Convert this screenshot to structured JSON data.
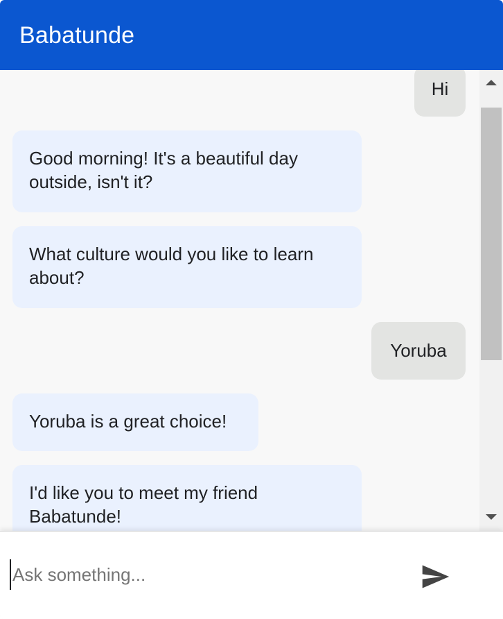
{
  "header": {
    "title": "Babatunde"
  },
  "messages": [
    {
      "sender": "user",
      "text": "Hi"
    },
    {
      "sender": "bot",
      "text": "Good morning! It's a beautiful day outside, isn't it?"
    },
    {
      "sender": "bot",
      "text": "What culture would you like to learn about?"
    },
    {
      "sender": "user",
      "text": "Yoruba"
    },
    {
      "sender": "bot",
      "text": "Yoruba is a great choice!"
    },
    {
      "sender": "bot",
      "text": "I'd like you to meet my friend Babatunde!"
    }
  ],
  "input": {
    "placeholder": "Ask something...",
    "value": ""
  },
  "icons": {
    "send": "send-icon",
    "scroll_up": "arrow-up-icon",
    "scroll_down": "arrow-down-icon"
  },
  "colors": {
    "header_bg": "#0b57d0",
    "header_text": "#ffffff",
    "bot_bubble": "#eaf1fe",
    "user_bubble": "#e3e4e2",
    "chat_bg": "#f8f8f8",
    "send_icon": "#444444"
  }
}
